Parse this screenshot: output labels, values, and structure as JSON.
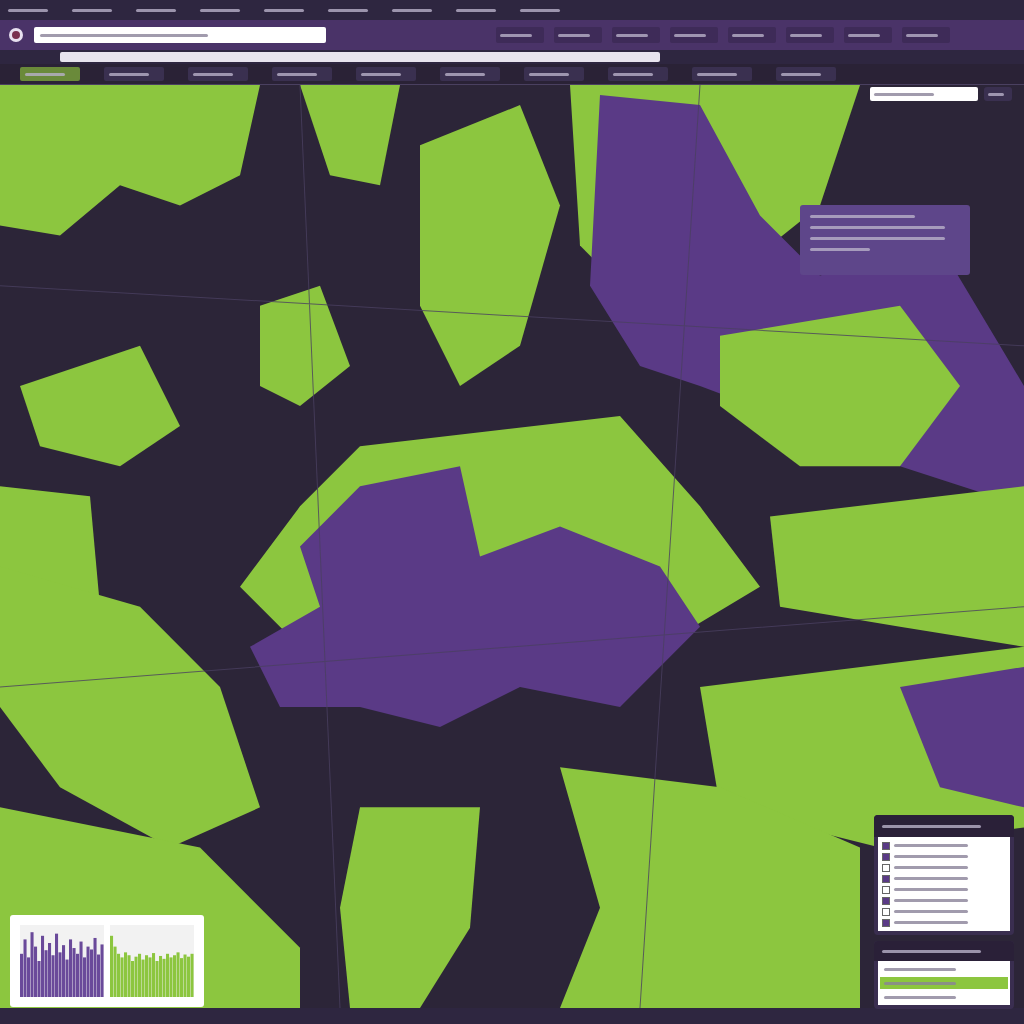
{
  "toolbar": {
    "buttons": [
      {
        "selected": true
      },
      {
        "selected": false
      },
      {
        "selected": false
      },
      {
        "selected": false
      },
      {
        "selected": false
      },
      {
        "selected": false
      },
      {
        "selected": false
      },
      {
        "selected": false
      },
      {
        "selected": false
      },
      {
        "selected": false
      }
    ]
  },
  "layers_panel": {
    "items": [
      {
        "checked": true
      },
      {
        "checked": true
      },
      {
        "checked": false
      },
      {
        "checked": true
      },
      {
        "checked": false
      },
      {
        "checked": true
      },
      {
        "checked": false
      },
      {
        "checked": true
      }
    ]
  },
  "results_panel": {
    "rows": [
      {
        "selected": false
      },
      {
        "selected": true
      },
      {
        "selected": false
      }
    ]
  }
}
